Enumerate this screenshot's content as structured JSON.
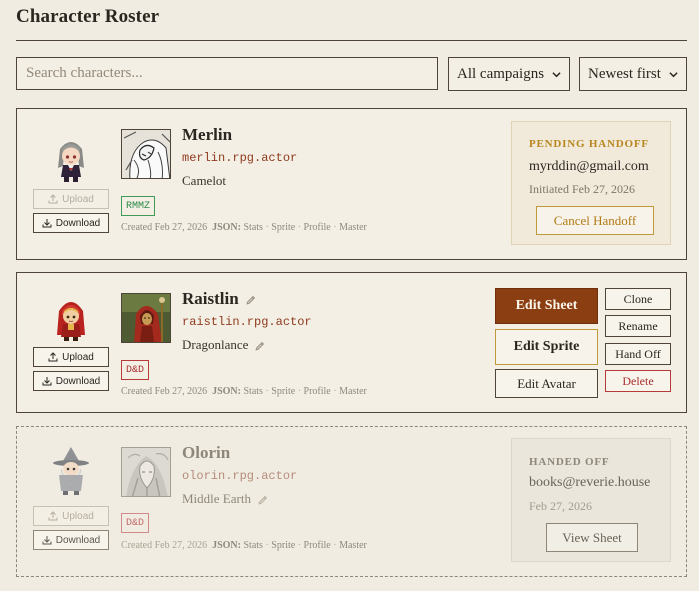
{
  "page": {
    "title": "Character Roster"
  },
  "search": {
    "placeholder": "Search characters..."
  },
  "filters": {
    "campaign": "All campaigns",
    "sort": "Newest first"
  },
  "common": {
    "upload": "Upload",
    "download": "Download",
    "created_prefix": "Created",
    "json_label": "JSON:",
    "json_links": [
      "Stats",
      "Sprite",
      "Profile",
      "Master"
    ]
  },
  "characters": [
    {
      "name": "Merlin",
      "handle": "merlin.rpg.actor",
      "realm": "Camelot",
      "tag": "RMMZ",
      "created": "Feb 27, 2026",
      "handoff": {
        "label": "PENDING HANDOFF",
        "email": "myrddin@gmail.com",
        "date": "Initiated Feb 27, 2026",
        "button": "Cancel Handoff"
      }
    },
    {
      "name": "Raistlin",
      "handle": "raistlin.rpg.actor",
      "realm": "Dragonlance",
      "tag": "D&D",
      "created": "Feb 27, 2026",
      "actions": {
        "edit_sheet": "Edit Sheet",
        "edit_sprite": "Edit Sprite",
        "edit_avatar": "Edit Avatar",
        "clone": "Clone",
        "rename": "Rename",
        "hand_off": "Hand Off",
        "delete": "Delete"
      }
    },
    {
      "name": "Olorin",
      "handle": "olorin.rpg.actor",
      "realm": "Middle Earth",
      "tag": "D&D",
      "created": "Feb 27, 2026",
      "handoff": {
        "label": "HANDED OFF",
        "email": "books@reverie.house",
        "date": "Feb 27, 2026",
        "button": "View Sheet"
      }
    }
  ],
  "colors": {
    "accent": "#8b3e12",
    "pending": "#b8861e",
    "danger": "#a92e2e",
    "tag_green": "#2f8a47",
    "background": "#f0ece1"
  }
}
